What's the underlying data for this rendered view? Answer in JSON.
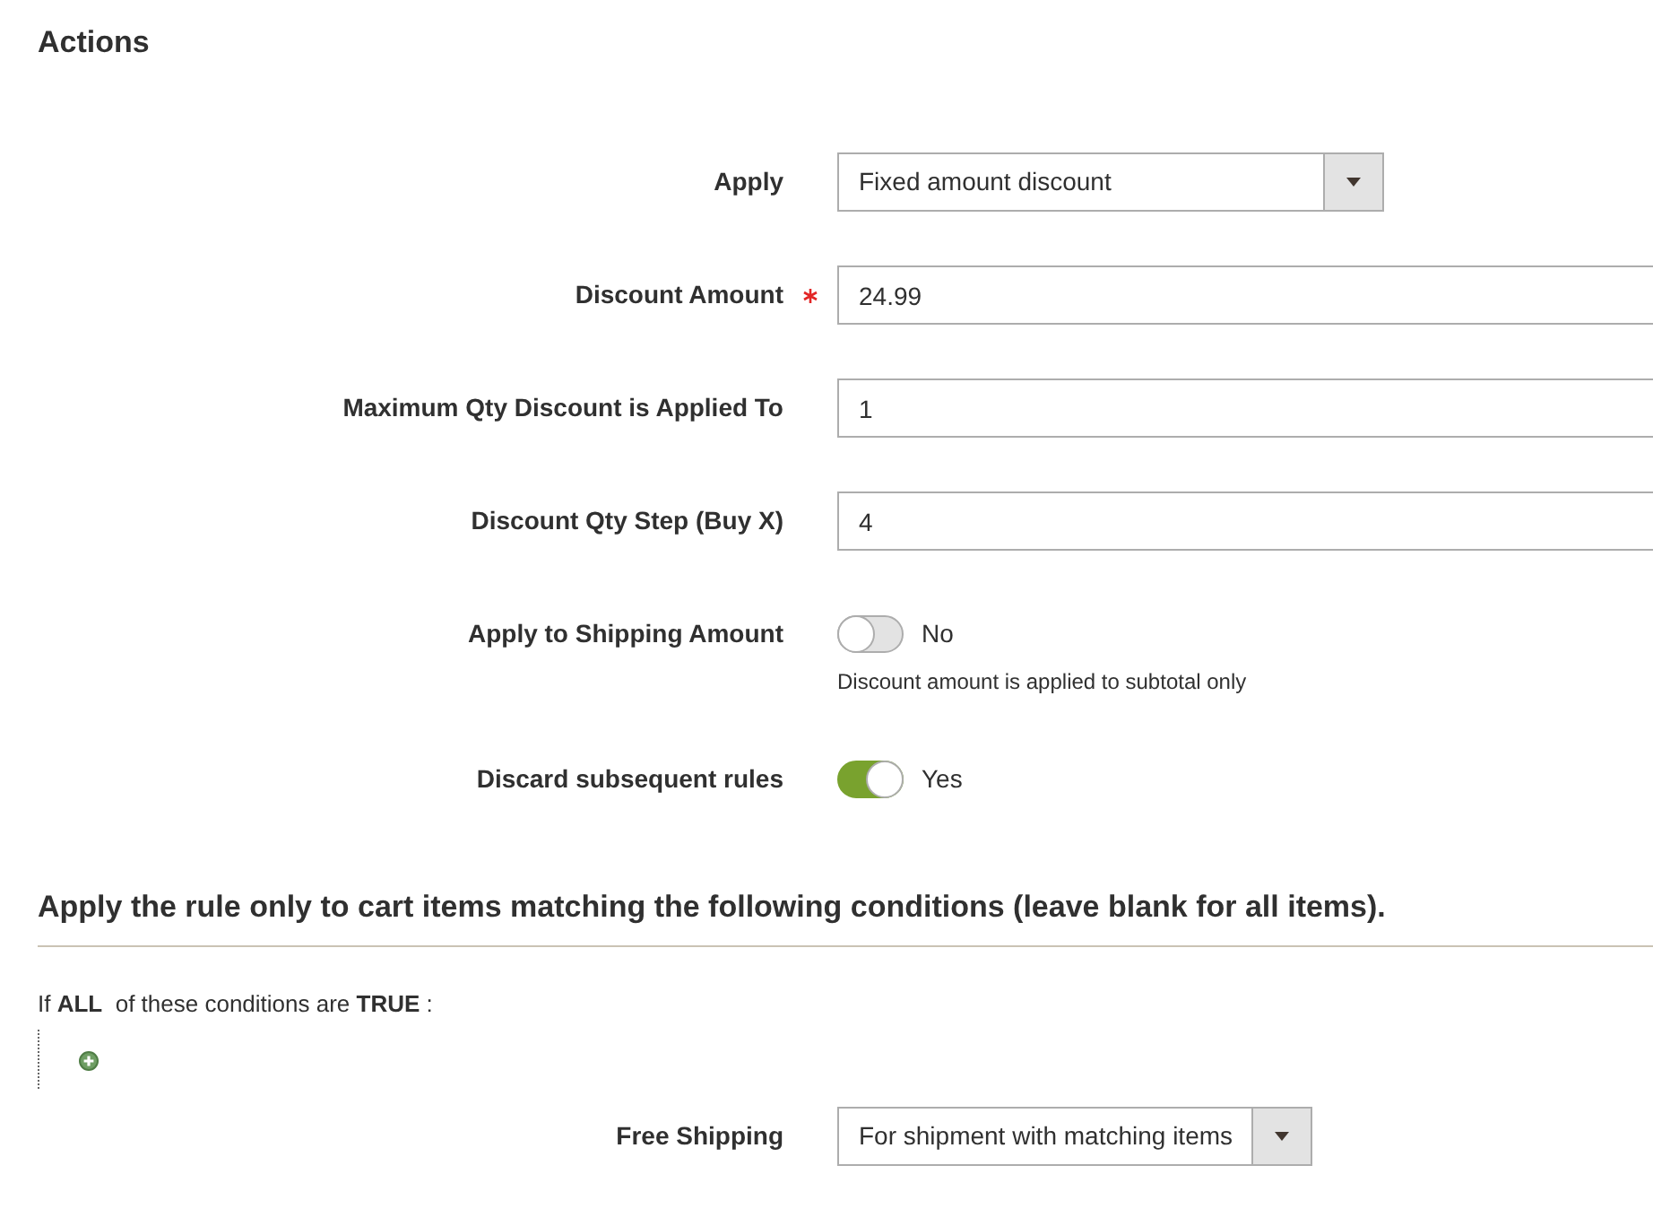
{
  "title": "Actions",
  "fields": [
    {
      "kind": "select",
      "label": "Apply",
      "value": "Fixed amount discount",
      "required": false
    },
    {
      "kind": "input",
      "label": "Discount Amount",
      "value": "24.99",
      "required": true
    },
    {
      "kind": "input",
      "label": "Maximum Qty Discount is Applied To",
      "value": "1",
      "required": false
    },
    {
      "kind": "input",
      "label": "Discount Qty Step (Buy X)",
      "value": "4",
      "required": false
    },
    {
      "kind": "toggle",
      "label": "Apply to Shipping Amount",
      "on": false,
      "state_text": "No",
      "note": "Discount amount is applied to subtotal only",
      "required": false
    },
    {
      "kind": "toggle",
      "label": "Discard subsequent rules",
      "on": true,
      "state_text": "Yes",
      "required": false
    }
  ],
  "conditions": {
    "heading": "Apply the rule only to cart items matching the following conditions (leave blank for all items).",
    "statement": "If **ALL**  of these conditions are **TRUE** :"
  },
  "free_shipping": {
    "label": "Free Shipping",
    "value": "For shipment with matching items"
  }
}
